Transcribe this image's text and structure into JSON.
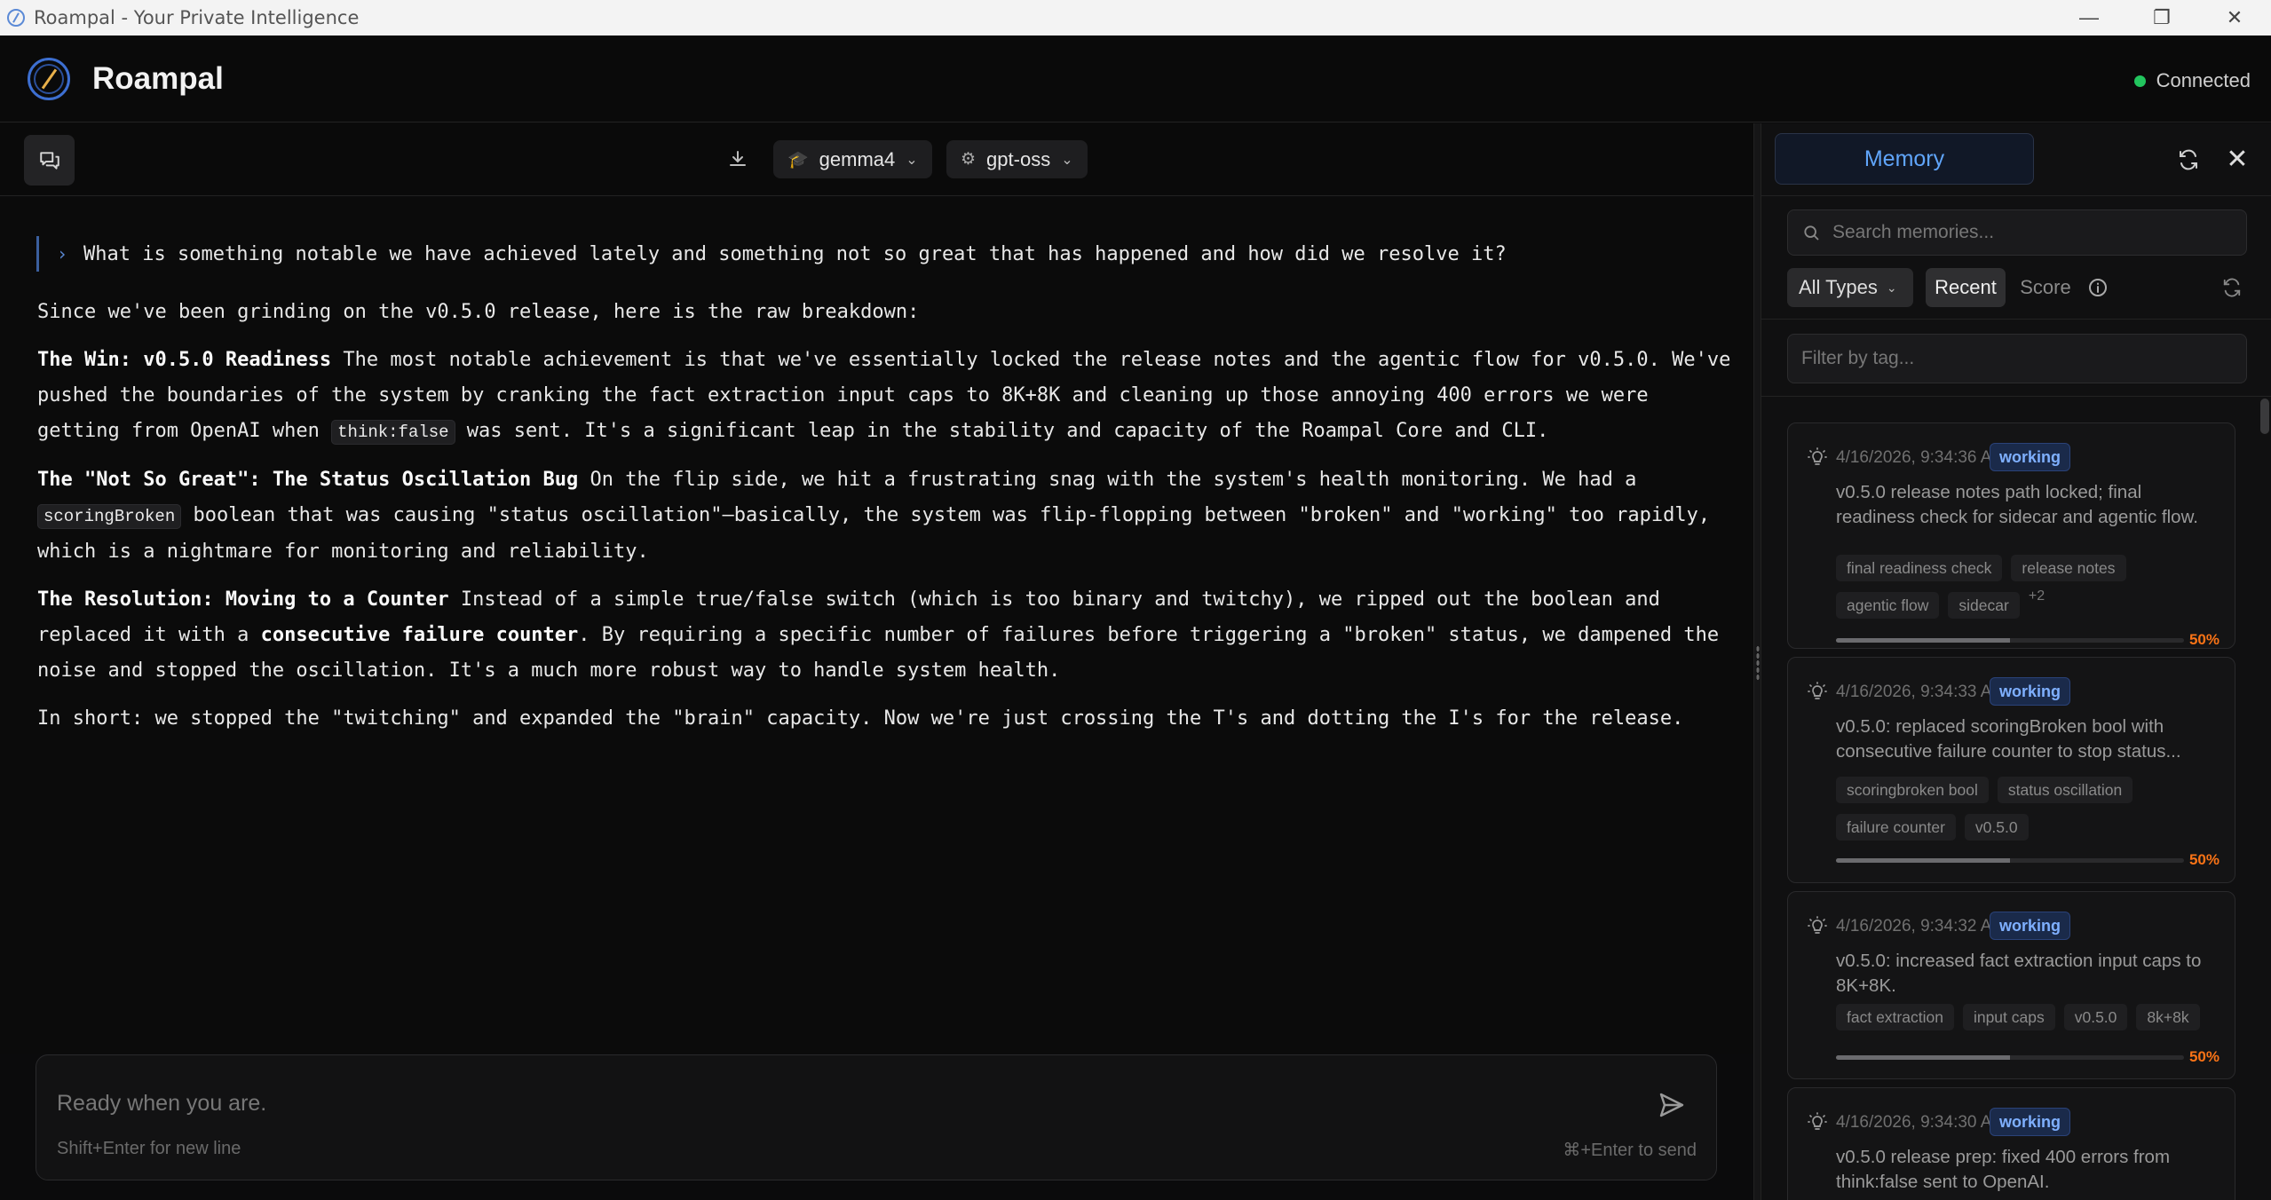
{
  "window": {
    "title": "Roampal - Your Private Intelligence",
    "controls": [
      "—",
      "❐",
      "✕"
    ]
  },
  "header": {
    "app_name": "Roampal",
    "status": "Connected",
    "status_color": "#22c55e"
  },
  "toolbar": {
    "model_primary": "gemma4",
    "model_secondary": "gpt-oss"
  },
  "chat": {
    "user_message": "What is something notable we have achieved lately and something not so great that has happened and how did we resolve it?",
    "reply": {
      "intro": "Since we've been grinding on the v0.5.0 release, here is the raw breakdown:",
      "p1_heading": "The Win: v0.5.0 Readiness",
      "p1_text_a": " The most notable achievement is that we've essentially locked the release notes and the agentic flow for v0.5.0. We've pushed the boundaries of the system by cranking the fact extraction input caps to 8K+8K and cleaning up those annoying 400 errors we were getting from OpenAI when ",
      "p1_code": "think:false",
      "p1_text_b": " was sent. It's a significant leap in the stability and capacity of the Roampal Core and CLI.",
      "p2_heading": "The \"Not So Great\": The Status Oscillation Bug",
      "p2_text_a": " On the flip side, we hit a frustrating snag with the system's health monitoring. We had a ",
      "p2_code": "scoringBroken",
      "p2_text_b": " boolean that was causing \"status oscillation\"—basically, the system was flip-flopping between \"broken\" and \"working\" too rapidly, which is a nightmare for monitoring and reliability.",
      "p3_heading": "The Resolution: Moving to a Counter",
      "p3_text_a": " Instead of a simple true/false switch (which is too binary and twitchy), we ripped out the boolean and replaced it with a ",
      "p3_bold": "consecutive failure counter",
      "p3_text_b": ". By requiring a specific number of failures before triggering a \"broken\" status, we dampened the noise and stopped the oscillation. It's a much more robust way to handle system health.",
      "outro": "In short: we stopped the \"twitching\" and expanded the \"brain\" capacity. Now we're just crossing the T's and dotting the I's for the release."
    }
  },
  "composer": {
    "placeholder": "Ready when you are.",
    "hint_left": "Shift+Enter for new line",
    "hint_right": "⌘+Enter to send"
  },
  "memory": {
    "tab_label": "Memory",
    "search_placeholder": "Search memories...",
    "type_filter": "All Types",
    "sort_recent": "Recent",
    "sort_score": "Score",
    "tag_filter_placeholder": "Filter by tag...",
    "cards": [
      {
        "time": "4/16/2026, 9:34:36 AM",
        "badge": "working",
        "text": "v0.5.0 release notes path locked; final readiness check for sidecar and agentic flow.",
        "tags": [
          "final readiness check",
          "release notes",
          "agentic flow",
          "sidecar"
        ],
        "more": "+2",
        "score": 0.5,
        "score_label": "50%"
      },
      {
        "time": "4/16/2026, 9:34:33 AM",
        "badge": "working",
        "text": "v0.5.0: replaced scoringBroken bool with consecutive failure counter to stop status...",
        "tags": [
          "scoringbroken bool",
          "status oscillation",
          "failure counter",
          "v0.5.0"
        ],
        "more": "",
        "score": 0.5,
        "score_label": "50%"
      },
      {
        "time": "4/16/2026, 9:34:32 AM",
        "badge": "working",
        "text": "v0.5.0: increased fact extraction input caps to 8K+8K.",
        "tags": [
          "fact extraction",
          "input caps",
          "v0.5.0",
          "8k+8k"
        ],
        "more": "",
        "score": 0.5,
        "score_label": "50%"
      },
      {
        "time": "4/16/2026, 9:34:30 AM",
        "badge": "working",
        "text": "v0.5.0 release prep: fixed 400 errors from think:false sent to OpenAI.",
        "tags": [],
        "more": "",
        "score": null,
        "score_label": ""
      }
    ]
  }
}
